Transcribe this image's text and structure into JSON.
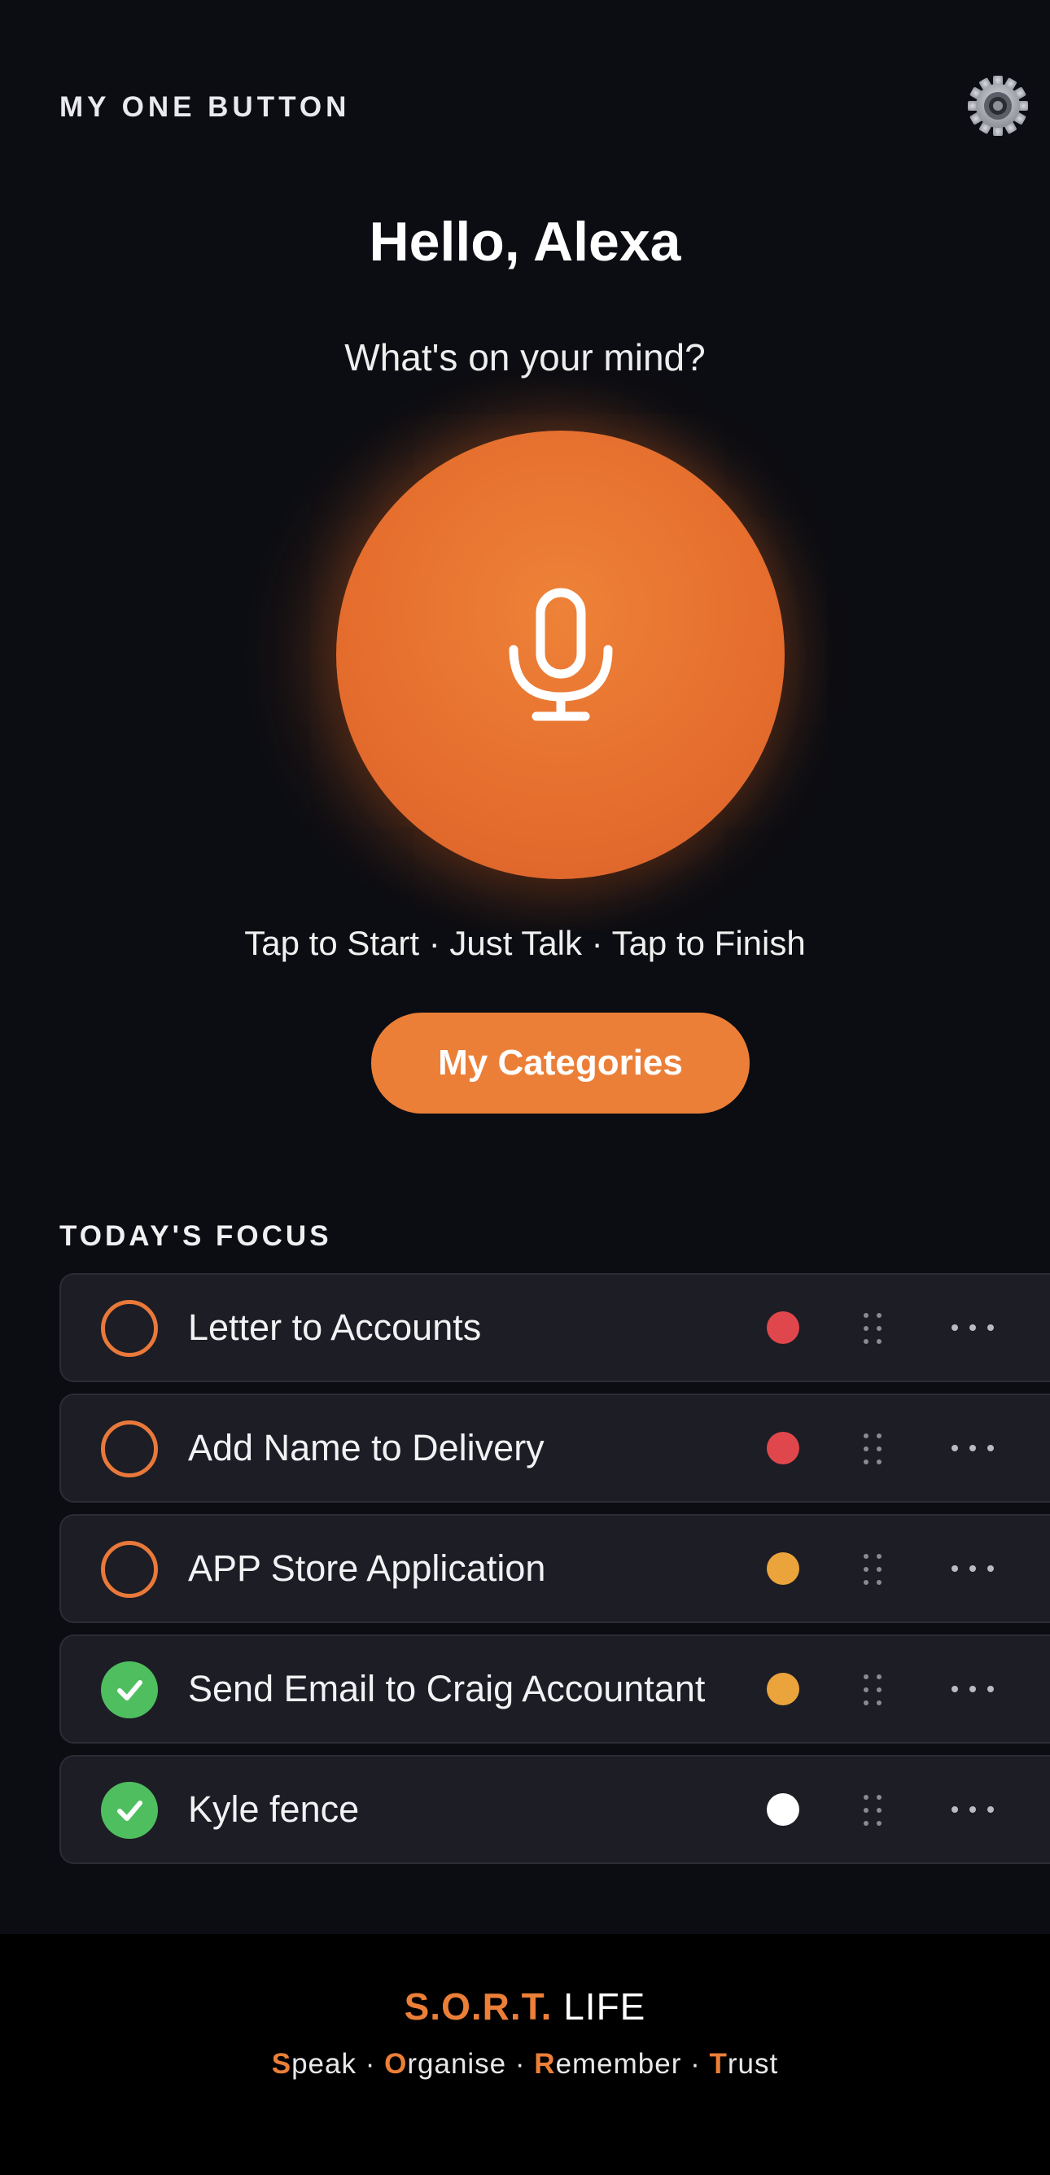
{
  "header": {
    "app_label": "MY ONE BUTTON",
    "settings_icon": "gear-icon"
  },
  "greeting": "Hello, Alexa",
  "prompt": "What's on your mind?",
  "record_button": {
    "icon": "microphone-icon"
  },
  "hint": "Tap to Start · Just Talk · Tap to Finish",
  "categories_button": "My Categories",
  "focus": {
    "title": "TODAY'S FOCUS",
    "tasks": [
      {
        "title": "Letter to Accounts",
        "done": false,
        "priority_color": "#e0474c"
      },
      {
        "title": "Add Name to Delivery",
        "done": false,
        "priority_color": "#e0474c"
      },
      {
        "title": "APP Store Application",
        "done": false,
        "priority_color": "#eba33c"
      },
      {
        "title": "Send Email to Craig Accountant",
        "done": true,
        "priority_color": "#eba33c"
      },
      {
        "title": "Kyle fence",
        "done": true,
        "priority_color": "#ffffff"
      }
    ]
  },
  "footer": {
    "brand_accent": "S.O.R.T.",
    "brand_rest": " LIFE",
    "tagline": [
      {
        "initial": "S",
        "rest": "peak"
      },
      {
        "initial": "O",
        "rest": "rganise"
      },
      {
        "initial": "R",
        "rest": "emember"
      },
      {
        "initial": "T",
        "rest": "rust"
      }
    ]
  },
  "colors": {
    "accent": "#ec7f38",
    "done_green": "#4fbe5f",
    "background": "#0c0d12",
    "card": "#1c1d25"
  }
}
